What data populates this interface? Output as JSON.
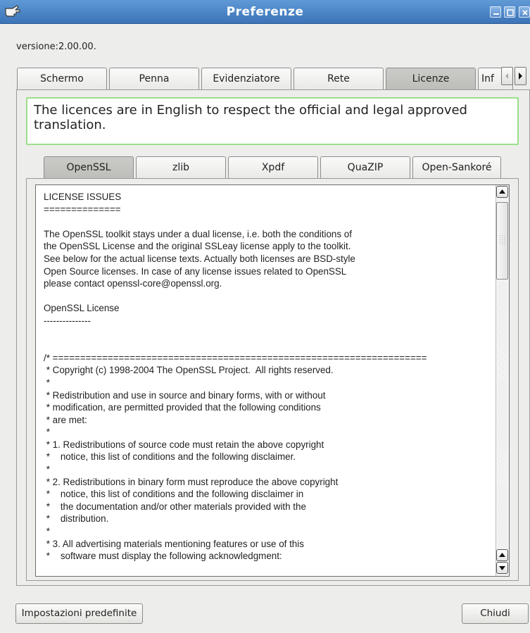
{
  "window": {
    "title": "Preferenze"
  },
  "version_label": "versione:2.00.00.",
  "tabs": [
    {
      "label": "Schermo",
      "active": false
    },
    {
      "label": "Penna",
      "active": false
    },
    {
      "label": "Evidenziatore",
      "active": false
    },
    {
      "label": "Rete",
      "active": false
    },
    {
      "label": "Licenze",
      "active": true
    },
    {
      "label": "Inf",
      "active": false
    }
  ],
  "notice": "The licences are in English to respect the official and legal approved translation.",
  "license_tabs": [
    {
      "label": "OpenSSL",
      "active": true
    },
    {
      "label": "zlib",
      "active": false
    },
    {
      "label": "Xpdf",
      "active": false
    },
    {
      "label": "QuaZIP",
      "active": false
    },
    {
      "label": "Open-Sankoré",
      "active": false
    }
  ],
  "license_text": "LICENSE ISSUES\n==============\n\nThe OpenSSL toolkit stays under a dual license, i.e. both the conditions of\nthe OpenSSL License and the original SSLeay license apply to the toolkit.\nSee below for the actual license texts. Actually both licenses are BSD-style\nOpen Source licenses. In case of any license issues related to OpenSSL\nplease contact openssl-core@openssl.org.\n\nOpenSSL License\n---------------\n\n\n/* ====================================================================\n * Copyright (c) 1998-2004 The OpenSSL Project.  All rights reserved.\n *\n * Redistribution and use in source and binary forms, with or without\n * modification, are permitted provided that the following conditions\n * are met:\n *\n * 1. Redistributions of source code must retain the above copyright\n *    notice, this list of conditions and the following disclaimer.\n *\n * 2. Redistributions in binary form must reproduce the above copyright\n *    notice, this list of conditions and the following disclaimer in\n *    the documentation and/or other materials provided with the\n *    distribution.\n *\n * 3. All advertising materials mentioning features or use of this\n *    software must display the following acknowledgment:",
  "buttons": {
    "defaults": "Impostazioni predefinite",
    "close": "Chiudi"
  },
  "colors": {
    "titlebar": "#4a85c6",
    "notice_border": "#9adf8a",
    "active_tab": "#c4c4c0"
  },
  "icons": {
    "app": "hand-pointer-icon",
    "minimize": "minimize-icon",
    "maximize": "maximize-icon",
    "close": "close-icon"
  }
}
